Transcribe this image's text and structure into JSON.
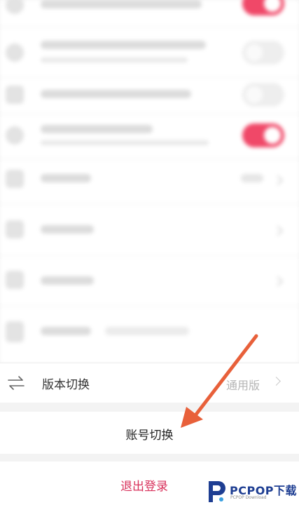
{
  "settings": {
    "version_switch": {
      "label": "版本切换",
      "value": "通用版",
      "icon": "swap-arrows-icon"
    },
    "account_switch": {
      "label": "账号切换"
    },
    "logout": {
      "label": "退出登录"
    }
  },
  "toggles": [
    {
      "state": "on"
    },
    {
      "state": "off"
    },
    {
      "state": "off"
    },
    {
      "state": "on"
    }
  ],
  "colors": {
    "accent": "#f04868",
    "logout_text": "#d8315b",
    "annotation_arrow": "#e8603a",
    "watermark": "#1e3e92"
  },
  "watermark": {
    "brand": "PCPOP下载",
    "sub": "PCPOP Download",
    "icon": "pcpop-logo-icon"
  }
}
